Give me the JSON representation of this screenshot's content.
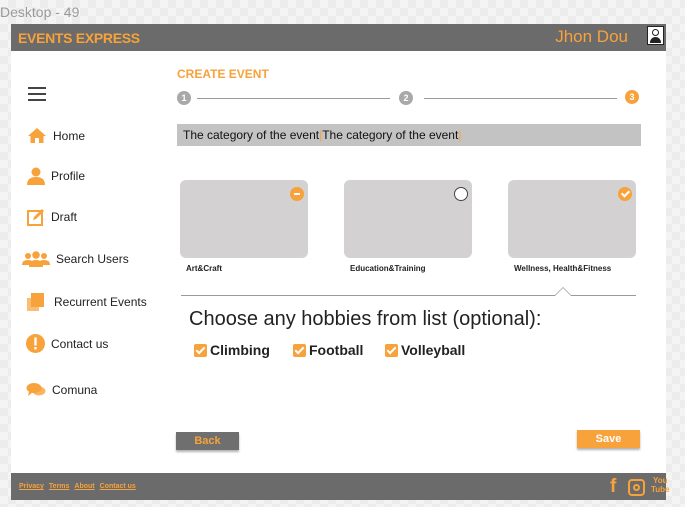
{
  "frame": {
    "title": "Desktop - 49"
  },
  "header": {
    "brand": "EVENTS EXPRESS",
    "user_name": "Jhon Dou"
  },
  "sidebar": {
    "items": [
      {
        "label": "Home",
        "icon": "home-icon"
      },
      {
        "label": "Profile",
        "icon": "profile-icon"
      },
      {
        "label": "Draft",
        "icon": "draft-icon"
      },
      {
        "label": "Search Users",
        "icon": "users-icon"
      },
      {
        "label": "Recurrent Events",
        "icon": "copy-icon"
      },
      {
        "label": "Contact us",
        "icon": "alert-icon"
      },
      {
        "label": "Comuna",
        "icon": "chat-icon"
      }
    ]
  },
  "main": {
    "title": "CREATE EVENT",
    "steps": [
      {
        "number": "1",
        "active": false
      },
      {
        "number": "2",
        "active": false
      },
      {
        "number": "3",
        "active": true
      }
    ],
    "category_text": "The category of the event",
    "category_text_repeat": "The category of the event",
    "categories": [
      {
        "label": "Art&Craft",
        "state": "partial"
      },
      {
        "label": "Education&Training",
        "state": "unselected"
      },
      {
        "label": "Wellness, Health&Fitness",
        "state": "selected"
      }
    ],
    "hobbies_title": "Choose any hobbies from list (optional):",
    "hobbies": [
      {
        "label": "Climbing",
        "checked": true
      },
      {
        "label": "Football",
        "checked": true
      },
      {
        "label": "Volleyball",
        "checked": true
      }
    ],
    "back_label": "Back",
    "save_label": "Save"
  },
  "footer": {
    "links": [
      "Privacy",
      "Terms",
      "About",
      "Contact us"
    ],
    "social": {
      "facebook": "f",
      "youtube_top": "You",
      "youtube_bottom": "Tube"
    }
  },
  "colors": {
    "accent": "#f7a23b",
    "bar": "#6b6b6b",
    "card": "#d3d1d2",
    "category_bar": "#c3c3c3"
  }
}
